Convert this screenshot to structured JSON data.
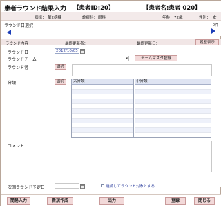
{
  "header": {
    "title": "患者ラウンド結果入力",
    "patient_id": "【患者ID:20】",
    "patient_name": "【患者名:患者 020】"
  },
  "patient_info": {
    "ward_label": "病棟：",
    "ward_value": "第2病棟",
    "dept_label": "診療科：",
    "dept_value": "眼科",
    "age_label": "年齢：",
    "age_value": "72歳",
    "sex_label": "性別：",
    "sex_value": "女"
  },
  "round_select": {
    "label": "ラウンド日選択",
    "count": "0件"
  },
  "content_header": {
    "round_content_label": "ラウンド内容",
    "last_updater_label": "最終更新者：",
    "last_update_date_label": "最終更新日：",
    "history_button": "履歴表示"
  },
  "form": {
    "round_date_label": "ラウンド日",
    "round_date_value": "2012/10/05",
    "round_team_label": "ラウンドチーム",
    "team_master_button": "チームマスタ登録",
    "rounder_label": "ラウンド者",
    "select_button": "選択",
    "classification_label": "分類",
    "classification_select_button": "選択",
    "major_category_header": "大分類",
    "minor_category_header": "小分類",
    "comment_label": "コメント",
    "next_round_label": "次回ラウンド予定日",
    "continue_checkbox_label": "継続してラウンド対象とする"
  },
  "footer": {
    "simple_input": "簡易入力",
    "new_create": "新規作成",
    "print": "出力",
    "register": "登録",
    "close": "閉じる"
  },
  "colors": {
    "accent_pink": "#f2d9d9",
    "arrow_blue": "#1d3fb8",
    "grid_header": "#dfe4f2"
  }
}
